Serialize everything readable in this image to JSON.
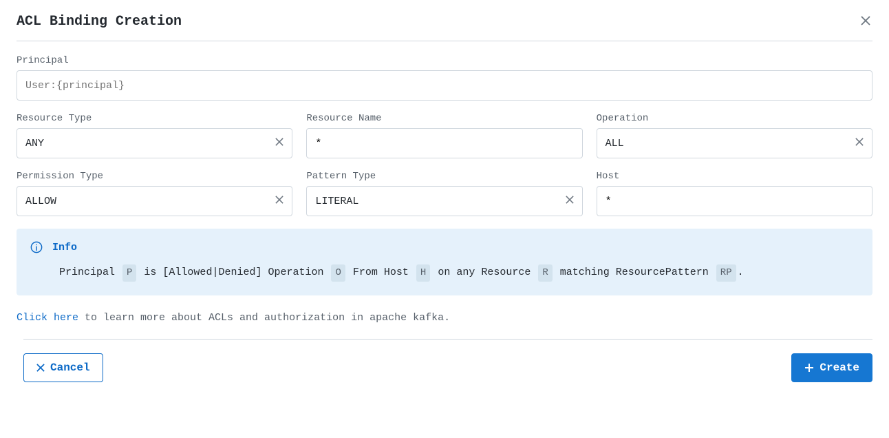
{
  "dialog": {
    "title": "ACL Binding Creation"
  },
  "form": {
    "principal": {
      "label": "Principal",
      "placeholder": "User:{principal}",
      "value": ""
    },
    "resource_type": {
      "label": "Resource Type",
      "value": "ANY"
    },
    "resource_name": {
      "label": "Resource Name",
      "value": "*"
    },
    "operation": {
      "label": "Operation",
      "value": "ALL"
    },
    "permission_type": {
      "label": "Permission Type",
      "value": "ALLOW"
    },
    "pattern_type": {
      "label": "Pattern Type",
      "value": "LITERAL"
    },
    "host": {
      "label": "Host",
      "value": "*"
    }
  },
  "info": {
    "title": "Info",
    "text": {
      "t0": "Principal ",
      "kP": "P",
      "t1": " is [Allowed|Denied] Operation ",
      "kO": "O",
      "t2": " From Host ",
      "kH": "H",
      "t3": " on any Resource ",
      "kR": "R",
      "t4": " matching ResourcePattern ",
      "kRP": "RP",
      "t5": "."
    }
  },
  "learn_more": {
    "link": "Click here",
    "rest": " to learn more about ACLs and authorization in apache kafka."
  },
  "buttons": {
    "cancel": "Cancel",
    "create": "Create"
  }
}
